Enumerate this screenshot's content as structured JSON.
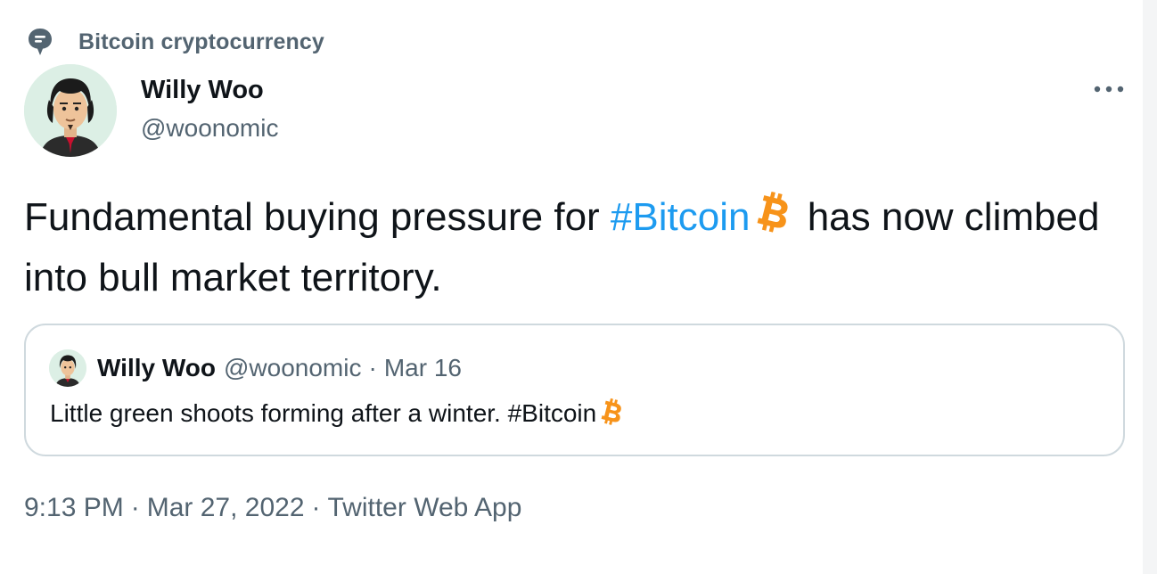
{
  "topic": {
    "label": "Bitcoin cryptocurrency",
    "icon": "topic-bubble-icon"
  },
  "tweet": {
    "author": {
      "name": "Willy Woo",
      "handle": "@woonomic",
      "avatar": "avatar-illustration"
    },
    "more_icon": "more-options-icon",
    "text_before": "Fundamental buying pressure for ",
    "hashtag": "#Bitcoin",
    "text_after": " has now climbed into bull market territory.",
    "emoji": "bitcoin-icon"
  },
  "quoted_tweet": {
    "name": "Willy Woo",
    "handle": "@woonomic",
    "separator": "·",
    "date": "Mar 16",
    "text_before": "Little green shoots forming after a winter. ",
    "hashtag": "#Bitcoin",
    "emoji": "bitcoin-icon"
  },
  "meta": {
    "time": "9:13 PM",
    "separator": "·",
    "date": "Mar 27, 2022",
    "source": "Twitter Web App"
  },
  "colors": {
    "text": "#0f1419",
    "secondary": "#536471",
    "link": "#1d9bf0",
    "border": "#cfd9de",
    "bitcoin": "#f7931a"
  }
}
